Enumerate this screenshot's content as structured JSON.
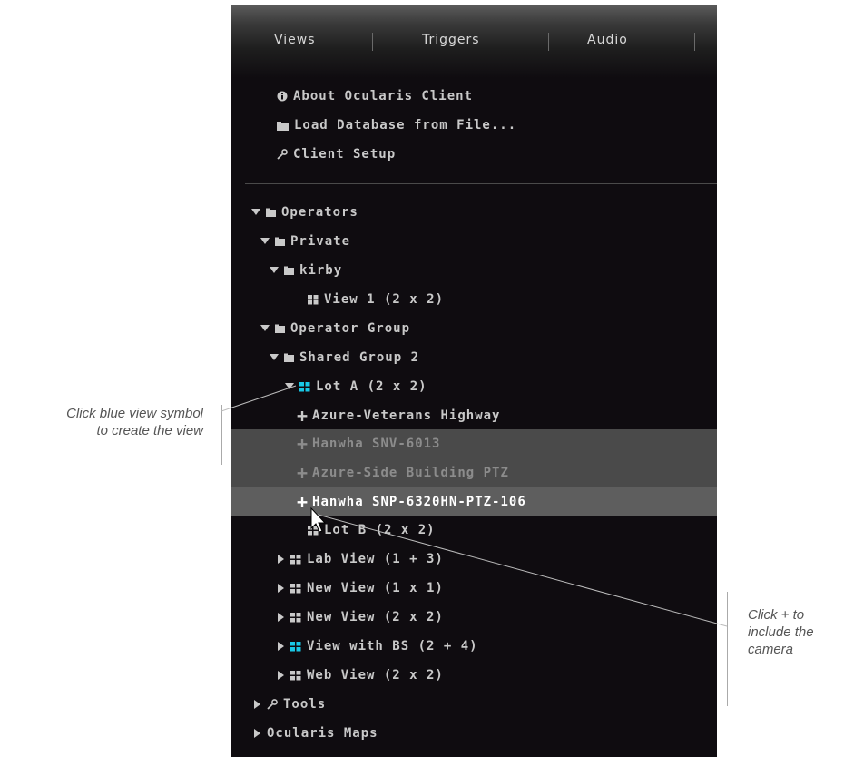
{
  "tabs": [
    {
      "label": "Views"
    },
    {
      "label": "Triggers"
    },
    {
      "label": "Audio"
    }
  ],
  "menu": [
    {
      "label": "About Ocularis Client",
      "icon": "info-icon"
    },
    {
      "label": "Load Database from File...",
      "icon": "folder-icon"
    },
    {
      "label": "Client Setup",
      "icon": "wrench-icon"
    }
  ],
  "tree": [
    {
      "label": "Operators",
      "expander": "expanded",
      "icon": "folder-icon"
    },
    {
      "label": "Private",
      "expander": "expanded",
      "icon": "folder-icon"
    },
    {
      "label": "kirby",
      "expander": "expanded",
      "icon": "folder-icon"
    },
    {
      "label": "View 1 (2 x 2)",
      "icon": "grid-view-icon"
    },
    {
      "label": "Operator Group",
      "expander": "expanded",
      "icon": "folder-icon"
    },
    {
      "label": "Shared Group 2",
      "expander": "expanded",
      "icon": "folder-icon"
    },
    {
      "label": "Lot A (2 x 2)",
      "expander": "expanded",
      "icon": "blue-grid-view-icon"
    },
    {
      "label": "Azure-Veterans Highway",
      "icon": "plus-icon"
    },
    {
      "label": "Hanwha SNV-6013",
      "icon": "plus-icon",
      "state": "highlighted"
    },
    {
      "label": "Azure-Side Building PTZ",
      "icon": "plus-icon",
      "state": "highlighted"
    },
    {
      "label": "Hanwha SNP-6320HN-PTZ-106",
      "icon": "plus-icon",
      "state": "selected"
    },
    {
      "label": "Lot B (2 x 2)",
      "icon": "grid-view-icon"
    },
    {
      "label": "Lab View (1 + 3)",
      "expander": "collapsed",
      "icon": "grid-view-icon"
    },
    {
      "label": "New View (1 x 1)",
      "expander": "collapsed",
      "icon": "grid-view-icon"
    },
    {
      "label": "New View (2 x 2)",
      "expander": "collapsed",
      "icon": "grid-view-icon"
    },
    {
      "label": "View with BS (2 + 4)",
      "expander": "collapsed",
      "icon": "blue-grid-view-icon"
    },
    {
      "label": "Web View (2 x 2)",
      "expander": "collapsed",
      "icon": "grid-view-icon"
    },
    {
      "label": "Tools",
      "expander": "collapsed",
      "icon": "wrench-icon"
    },
    {
      "label": "Ocularis Maps",
      "expander": "collapsed"
    }
  ],
  "annotations": {
    "left": {
      "line1": "Click blue view symbol",
      "line2": "to create the view"
    },
    "right": {
      "line1": "Click + to",
      "line2": "include the",
      "line3": "camera"
    }
  },
  "colors": {
    "panel_bg": "#0f0c10",
    "text": "#c9c9c9",
    "view_accent": "#19c8e6",
    "selected_row": "#5e5e5e",
    "highlight_row": "#4a4a4a"
  }
}
